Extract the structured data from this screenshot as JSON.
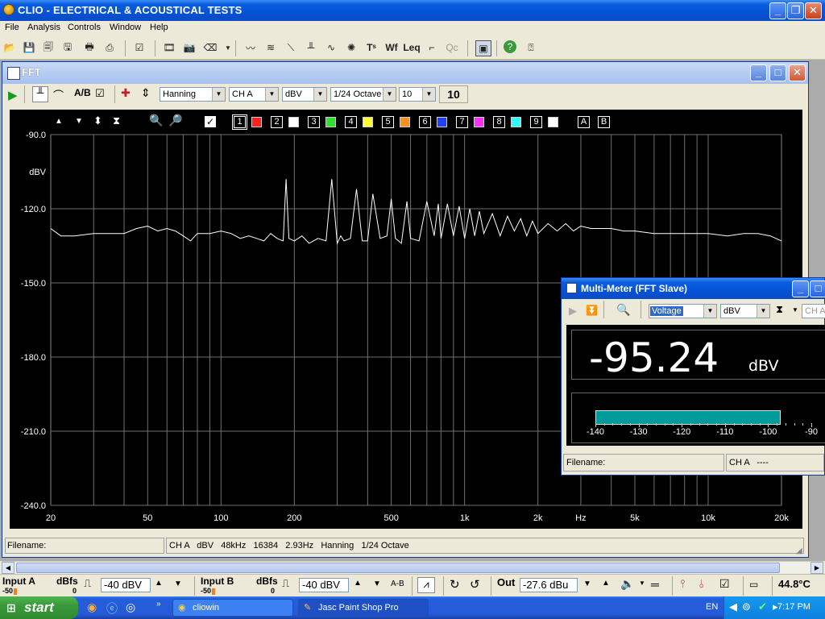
{
  "app": {
    "title": "CLIO - ELECTRICAL & ACOUSTICAL TESTS"
  },
  "menu": [
    "File",
    "Analysis",
    "Controls",
    "Window",
    "Help"
  ],
  "fft": {
    "title": "FFT",
    "window_func": "Hanning",
    "channel": "CH A",
    "unit": "dBV",
    "smoothing": "1/24 Octave",
    "averages_select": "10",
    "averages_count": "10",
    "overlay_numbers": [
      "1",
      "2",
      "3",
      "4",
      "5",
      "6",
      "7",
      "8",
      "9"
    ],
    "overlay_letters": [
      "A",
      "B"
    ],
    "status_filename_label": "Filename:",
    "status_info": "CH A   dBV   48kHz   16384   2.93Hz   Hanning   1/24 Octave"
  },
  "overlay_colors": [
    "#ff2020",
    "#ffffff",
    "#30e030",
    "#ffff30",
    "#ff9020",
    "#2040ff",
    "#ff30ff",
    "#30ffff",
    "#ffffff"
  ],
  "chart_data": {
    "type": "line",
    "title": "",
    "xlabel": "Hz",
    "ylabel": "dBV",
    "x_scale": "log",
    "xlim": [
      20,
      20000
    ],
    "ylim": [
      -240,
      -90
    ],
    "y_ticks": [
      "-90.0",
      "-120.0",
      "-150.0",
      "-180.0",
      "-210.0",
      "-240.0"
    ],
    "x_ticks": [
      {
        "v": 20,
        "label": "20"
      },
      {
        "v": 50,
        "label": "50"
      },
      {
        "v": 100,
        "label": "100"
      },
      {
        "v": 200,
        "label": "200"
      },
      {
        "v": 500,
        "label": "500"
      },
      {
        "v": 1000,
        "label": "1k"
      },
      {
        "v": 2000,
        "label": "2k"
      },
      {
        "v": 5000,
        "label": "5k"
      },
      {
        "v": 10000,
        "label": "10k"
      },
      {
        "v": 20000,
        "label": "20k"
      }
    ],
    "x_unit_label": "Hz",
    "y_unit_label": "dBV",
    "grid": true,
    "series": [
      {
        "color": "#ffffff",
        "x": [
          20,
          22,
          25,
          30,
          35,
          40,
          45,
          50,
          55,
          60,
          65,
          70,
          75,
          80,
          90,
          100,
          110,
          120,
          130,
          140,
          150,
          160,
          170,
          180,
          185,
          190,
          200,
          215,
          230,
          250,
          270,
          285,
          300,
          310,
          320,
          340,
          360,
          380,
          400,
          420,
          450,
          480,
          500,
          520,
          550,
          580,
          600,
          650,
          700,
          750,
          780,
          800,
          850,
          900,
          950,
          1000,
          1050,
          1100,
          1150,
          1200,
          1300,
          1400,
          1500,
          1600,
          1700,
          1800,
          1900,
          2000,
          2200,
          2400,
          2600,
          2800,
          3000,
          3300,
          3600,
          4000,
          4500,
          5000,
          6000,
          7000,
          8000,
          9000,
          10000,
          12000,
          14000,
          16000,
          18000,
          20000
        ],
        "y": [
          -128,
          -131,
          -131,
          -130,
          -130,
          -130,
          -128,
          -127,
          -129,
          -128,
          -129,
          -131,
          -133,
          -130,
          -130,
          -129,
          -130,
          -132,
          -131,
          -132,
          -133,
          -130,
          -132,
          -133,
          -108,
          -132,
          -133,
          -131,
          -134,
          -132,
          -133,
          -108,
          -134,
          -131,
          -133,
          -132,
          -112,
          -133,
          -133,
          -114,
          -132,
          -131,
          -116,
          -132,
          -134,
          -117,
          -132,
          -133,
          -117,
          -131,
          -118,
          -132,
          -118,
          -131,
          -119,
          -132,
          -120,
          -131,
          -121,
          -130,
          -122,
          -131,
          -123,
          -129,
          -124,
          -131,
          -125,
          -130,
          -126,
          -129,
          -126,
          -129,
          -127,
          -128,
          -128,
          -128,
          -129,
          -129,
          -130,
          -130,
          -130,
          -130,
          -130,
          -131,
          -130,
          -130,
          -131,
          -133
        ]
      }
    ]
  },
  "multimeter": {
    "title": "Multi-Meter (FFT Slave)",
    "mode": "Voltage",
    "unit_select": "dBV",
    "channel_select": "CH A",
    "reading": "-95.24",
    "reading_unit": "dBV",
    "bar_range": [
      -140,
      -90
    ],
    "bar_value": -97,
    "bar_ticks": [
      "-140",
      "-130",
      "-120",
      "-110",
      "-100",
      "-90"
    ],
    "filename_label": "Filename:",
    "status": "CH A   ----"
  },
  "bottom": {
    "input_a_label": "Input A",
    "input_a_unit": "dBfs",
    "input_a_scale_min": "-50",
    "input_a_scale_max": "0",
    "input_a_value": "-40 dBV",
    "input_b_label": "Input B",
    "input_b_unit": "dBfs",
    "input_b_scale_min": "-50",
    "input_b_scale_max": "0",
    "input_b_value": "-40 dBV",
    "ab_label": "A-B",
    "out_label": "Out",
    "out_value": "-27.6 dBu",
    "temperature": "44.8°C"
  },
  "taskbar": {
    "start": "start",
    "tasks": [
      "cliowin",
      "Jasc Paint Shop Pro"
    ],
    "lang": "EN",
    "time": "7:17 PM"
  }
}
